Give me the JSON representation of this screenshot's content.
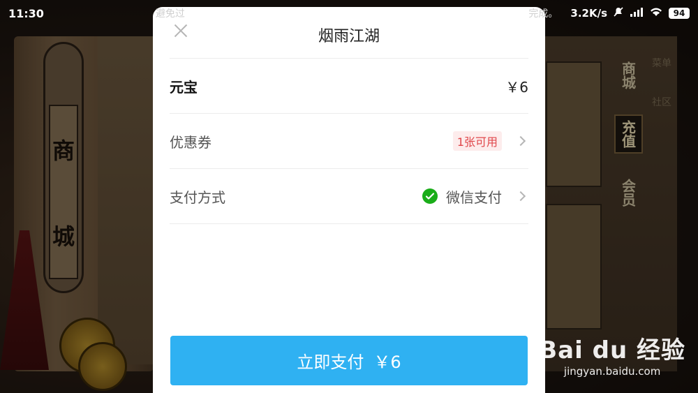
{
  "status_bar": {
    "time": "11:30",
    "notice_start": "避免过",
    "notice_end": "完成。",
    "network_speed": "3.2K/s",
    "battery": "94"
  },
  "background": {
    "scroll_chars": [
      "商",
      "城"
    ],
    "side_tabs": [
      "商城",
      "充值",
      "会员"
    ],
    "side_menu": [
      "菜单",
      "社区"
    ]
  },
  "sheet": {
    "title": "烟雨江湖",
    "item_label": "元宝",
    "item_price": "￥6",
    "coupon_label": "优惠券",
    "coupon_badge": "1张可用",
    "payment_label": "支付方式",
    "payment_method": "微信支付",
    "pay_button_text": "立即支付",
    "pay_button_amount": "￥6"
  },
  "watermark": {
    "logo": "Bai du 经验",
    "url": "jingyan.baidu.com"
  },
  "colors": {
    "accent": "#2fb1f2",
    "wechat_green": "#1aad19",
    "coupon_red": "#e0464a"
  }
}
